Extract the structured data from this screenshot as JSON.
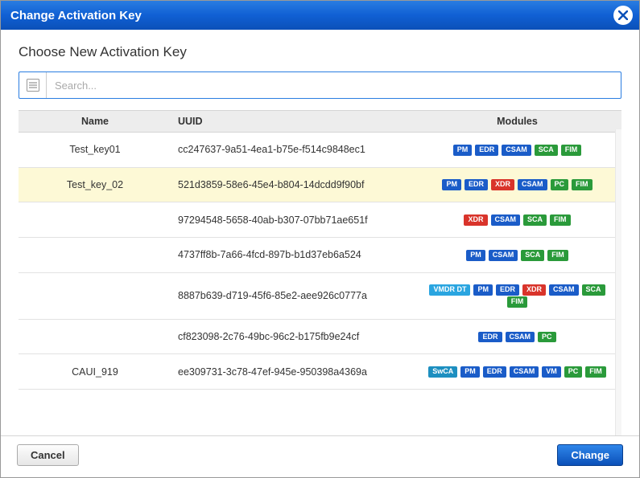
{
  "header": {
    "title": "Change Activation Key"
  },
  "subtitle": "Choose New Activation Key",
  "search": {
    "placeholder": "Search..."
  },
  "columns": {
    "name": "Name",
    "uuid": "UUID",
    "modules": "Modules"
  },
  "rows": [
    {
      "name": "Test_key01",
      "uuid": "cc247637-9a51-4ea1-b75e-f514c9848ec1",
      "selected": false,
      "modules": [
        "PM",
        "EDR",
        "CSAM",
        "SCA",
        "FIM"
      ]
    },
    {
      "name": "Test_key_02",
      "uuid": "521d3859-58e6-45e4-b804-14dcdd9f90bf",
      "selected": true,
      "modules": [
        "PM",
        "EDR",
        "XDR",
        "CSAM",
        "PC",
        "FIM"
      ]
    },
    {
      "name": "",
      "uuid": "97294548-5658-40ab-b307-07bb71ae651f",
      "selected": false,
      "modules": [
        "XDR",
        "CSAM",
        "SCA",
        "FIM"
      ]
    },
    {
      "name": "",
      "uuid": "4737ff8b-7a66-4fcd-897b-b1d37eb6a524",
      "selected": false,
      "modules": [
        "PM",
        "CSAM",
        "SCA",
        "FIM"
      ]
    },
    {
      "name": "",
      "uuid": "8887b639-d719-45f6-85e2-aee926c0777a",
      "selected": false,
      "modules": [
        "VMDR DT",
        "PM",
        "EDR",
        "XDR",
        "CSAM",
        "SCA",
        "FIM"
      ]
    },
    {
      "name": "",
      "uuid": "cf823098-2c76-49bc-96c2-b175fb9e24cf",
      "selected": false,
      "modules": [
        "EDR",
        "CSAM",
        "PC"
      ]
    },
    {
      "name": "CAUI_919",
      "uuid": "ee309731-3c78-47ef-945e-950398a4369a",
      "selected": false,
      "modules": [
        "SwCA",
        "PM",
        "EDR",
        "CSAM",
        "VM",
        "PC",
        "FIM"
      ]
    }
  ],
  "module_colors": {
    "PM": "b-blue",
    "EDR": "b-blue",
    "CSAM": "b-blue",
    "VM": "b-blue",
    "SCA": "b-green",
    "FIM": "b-green",
    "PC": "b-green",
    "XDR": "b-red",
    "SwCA": "b-teal",
    "VMDR DT": "b-cyan"
  },
  "footer": {
    "cancel": "Cancel",
    "change": "Change"
  }
}
